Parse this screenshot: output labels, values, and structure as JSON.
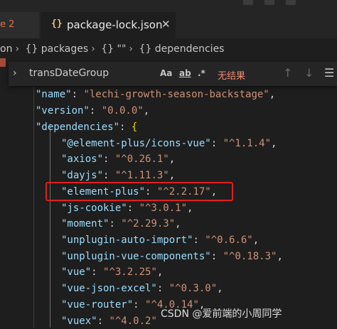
{
  "tabs": {
    "previous_tab_label": "e 2",
    "active_tab_icon": "{}",
    "active_tab_label": "package-lock.json",
    "close_glyph": "✕"
  },
  "breadcrumb": {
    "items": [
      "on",
      "{} packages",
      "{} \"\"",
      "{} dependencies"
    ]
  },
  "find": {
    "query": "transDateGroup",
    "match_case": "Aa",
    "whole_word": "ab",
    "regex": ".*",
    "result": "无结果"
  },
  "code_lines": [
    {
      "key": "\"name\"",
      "value": "\"lechi-growth-season-backstage\"",
      "tail": ","
    },
    {
      "key": "\"version\"",
      "value": "\"0.0.0\"",
      "tail": ","
    },
    {
      "key": "\"dependencies\"",
      "value": "{",
      "tail": ""
    },
    {
      "key": "\"@element-plus/icons-vue\"",
      "value": "\"^1.1.4\"",
      "tail": ","
    },
    {
      "key": "\"axios\"",
      "value": "\"^0.26.1\"",
      "tail": ","
    },
    {
      "key": "\"dayjs\"",
      "value": "\"^1.11.3\"",
      "tail": ","
    },
    {
      "key": "\"element-plus\"",
      "value": "\"^2.2.17\"",
      "tail": ","
    },
    {
      "key": "\"js-cookie\"",
      "value": "\"^3.0.1\"",
      "tail": ","
    },
    {
      "key": "\"moment\"",
      "value": "\"^2.29.3\"",
      "tail": ","
    },
    {
      "key": "\"unplugin-auto-import\"",
      "value": "\"^0.6.6\"",
      "tail": ","
    },
    {
      "key": "\"unplugin-vue-components\"",
      "value": "\"^0.18.3\"",
      "tail": ","
    },
    {
      "key": "\"vue\"",
      "value": "\"^3.2.25\"",
      "tail": ","
    },
    {
      "key": "\"vue-json-excel\"",
      "value": "\"^0.3.0\"",
      "tail": ","
    },
    {
      "key": "\"vue-router\"",
      "value": "\"^4.0.14\"",
      "tail": ","
    },
    {
      "key": "\"vuex\"",
      "value": "\"^4.0.2\"",
      "tail": ""
    }
  ],
  "watermark": "CSDN @爱前端的小周同学",
  "colors": {
    "key": "#9cdcfe",
    "string": "#ce9178",
    "highlight": "#e02020",
    "error_text": "#f48771"
  }
}
